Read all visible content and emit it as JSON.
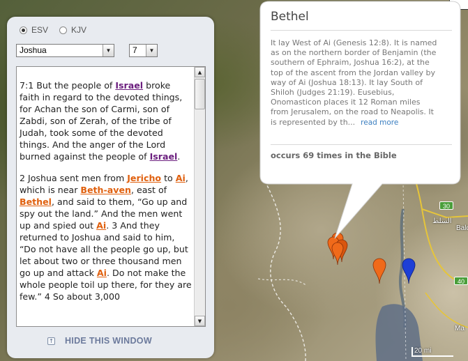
{
  "map": {
    "scale_label": "20 mi",
    "labels": [
      {
        "text": "السلط"
      },
      {
        "text": "Bald"
      },
      {
        "text": "Ma"
      }
    ],
    "shields": [
      "30",
      "40"
    ],
    "pin_colors": {
      "orange": "#f06a1a",
      "dark_orange": "#d9560f",
      "blue": "#1d3fd6"
    }
  },
  "panel": {
    "versions": [
      {
        "label": "ESV",
        "selected": true
      },
      {
        "label": "KJV",
        "selected": false
      }
    ],
    "book": "Joshua",
    "chapter": "7",
    "hide_label": "HIDE THIS WINDOW",
    "verses": [
      {
        "parts": [
          {
            "t": "7:1 But the people of "
          },
          {
            "t": "Israel",
            "place": "visited"
          },
          {
            "t": " broke faith in regard to the devoted things, for Achan the son of Carmi, son of Zabdi, son of Zerah, of the tribe of Judah, took some of the devoted things. And the anger of the Lord burned against the people of "
          },
          {
            "t": "Israel",
            "place": "visited"
          },
          {
            "t": "."
          }
        ]
      },
      {
        "parts": [
          {
            "t": "2 Joshua sent men from "
          },
          {
            "t": "Jericho",
            "place": "marked"
          },
          {
            "t": " to "
          },
          {
            "t": "Ai",
            "place": "marked"
          },
          {
            "t": ", which is near "
          },
          {
            "t": "Beth-aven",
            "place": "marked"
          },
          {
            "t": ", east of "
          },
          {
            "t": "Bethel",
            "place": "marked"
          },
          {
            "t": ", and said to them, “Go up and spy out the land.” And the men went up and spied out "
          },
          {
            "t": "Ai",
            "place": "marked"
          },
          {
            "t": ". 3 And they returned to Joshua and said to him, “Do not have all the people go up, but let about two or three thousand men go up and attack "
          },
          {
            "t": "Ai",
            "place": "marked"
          },
          {
            "t": ". Do not make the whole people toil up there, for they are few.” 4 So about 3,000"
          }
        ]
      }
    ]
  },
  "bubble": {
    "title": "Bethel",
    "description": "It lay West of Ai (Genesis 12:8). It is named as on the northern border of Benjamin (the southern of Ephraim, Joshua 16:2), at the top of the ascent from the Jordan valley by way of Ai (Joshua 18:13). It lay South of Shiloh (Judges 21:19). Eusebius, Onomasticon places it 12 Roman miles from Jerusalem, on the road to Neapolis. It is represented by th...",
    "read_more": "read more",
    "occurs": "occurs 69 times in the Bible"
  },
  "colors": {
    "visited_link": "#6b1e7e",
    "place_link": "#e0600e",
    "hide_label": "#6c7a9c"
  }
}
